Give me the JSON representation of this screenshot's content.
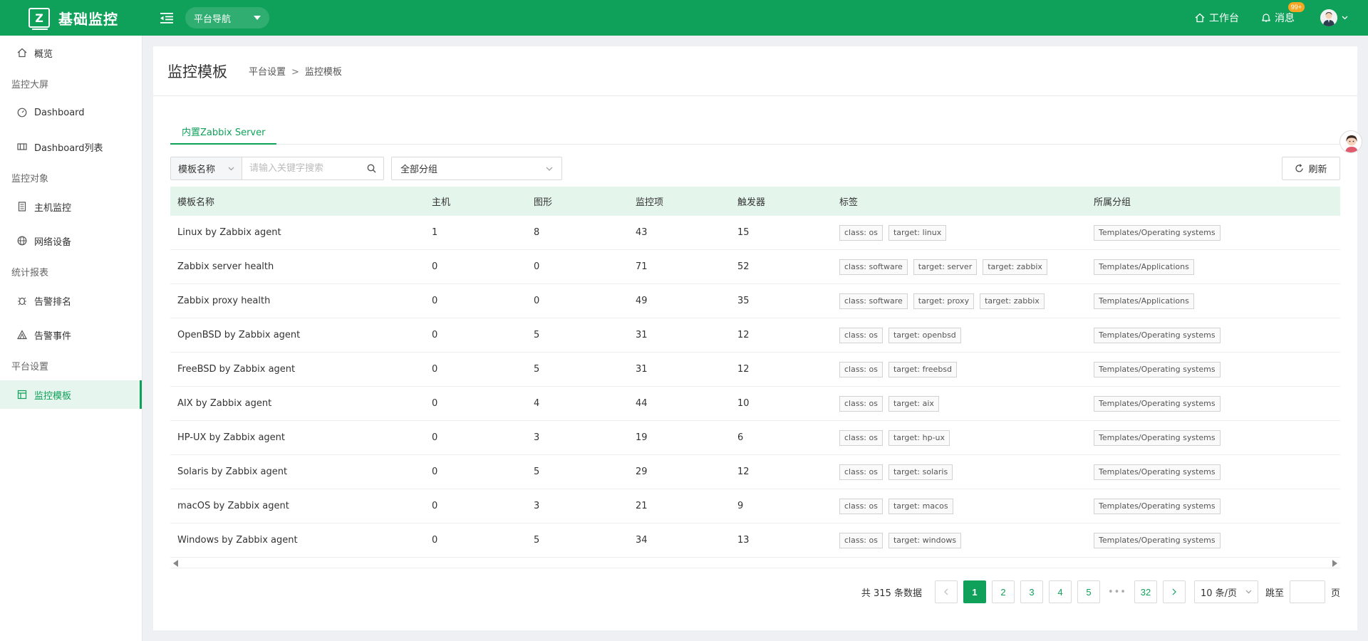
{
  "colors": {
    "brand": "#0fa15a",
    "sidebar_active_bg": "#e6f5ed",
    "table_head_bg": "#e4f5ec"
  },
  "header": {
    "logo_letter": "Z",
    "app_title": "基础监控",
    "nav_select": "平台导航",
    "workbench": "工作台",
    "messages": "消息",
    "messages_badge": "99+"
  },
  "sidebar": {
    "overview": "概览",
    "groups": {
      "screen": "监控大屏",
      "objects": "监控对象",
      "reports": "统计报表",
      "settings": "平台设置"
    },
    "items": {
      "dashboard": "Dashboard",
      "dashboard_list": "Dashboard列表",
      "host_monitor": "主机监控",
      "network_device": "网络设备",
      "alert_rank": "告警排名",
      "alert_event": "告警事件",
      "templates": "监控模板"
    }
  },
  "page": {
    "title": "监控模板",
    "breadcrumb": [
      "平台设置",
      "监控模板"
    ],
    "breadcrumb_sep": ">",
    "tab": "内置Zabbix Server"
  },
  "filters": {
    "search_type": "模板名称",
    "search_placeholder": "请输入关键字搜索",
    "group_select": "全部分组",
    "refresh": "刷新"
  },
  "table": {
    "headers": [
      "模板名称",
      "主机",
      "图形",
      "监控项",
      "触发器",
      "标签",
      "所属分组"
    ],
    "rows": [
      {
        "name": "Linux by Zabbix agent",
        "hosts": "1",
        "graphs": "8",
        "items": "43",
        "triggers": "15",
        "tags": [
          "class: os",
          "target: linux"
        ],
        "group": "Templates/Operating systems"
      },
      {
        "name": "Zabbix server health",
        "hosts": "0",
        "graphs": "0",
        "items": "71",
        "triggers": "52",
        "tags": [
          "class: software",
          "target: server",
          "target: zabbix"
        ],
        "group": "Templates/Applications"
      },
      {
        "name": "Zabbix proxy health",
        "hosts": "0",
        "graphs": "0",
        "items": "49",
        "triggers": "35",
        "tags": [
          "class: software",
          "target: proxy",
          "target: zabbix"
        ],
        "group": "Templates/Applications"
      },
      {
        "name": "OpenBSD by Zabbix agent",
        "hosts": "0",
        "graphs": "5",
        "items": "31",
        "triggers": "12",
        "tags": [
          "class: os",
          "target: openbsd"
        ],
        "group": "Templates/Operating systems"
      },
      {
        "name": "FreeBSD by Zabbix agent",
        "hosts": "0",
        "graphs": "5",
        "items": "31",
        "triggers": "12",
        "tags": [
          "class: os",
          "target: freebsd"
        ],
        "group": "Templates/Operating systems"
      },
      {
        "name": "AIX by Zabbix agent",
        "hosts": "0",
        "graphs": "4",
        "items": "44",
        "triggers": "10",
        "tags": [
          "class: os",
          "target: aix"
        ],
        "group": "Templates/Operating systems"
      },
      {
        "name": "HP-UX by Zabbix agent",
        "hosts": "0",
        "graphs": "3",
        "items": "19",
        "triggers": "6",
        "tags": [
          "class: os",
          "target: hp-ux"
        ],
        "group": "Templates/Operating systems"
      },
      {
        "name": "Solaris by Zabbix agent",
        "hosts": "0",
        "graphs": "5",
        "items": "29",
        "triggers": "12",
        "tags": [
          "class: os",
          "target: solaris"
        ],
        "group": "Templates/Operating systems"
      },
      {
        "name": "macOS by Zabbix agent",
        "hosts": "0",
        "graphs": "3",
        "items": "21",
        "triggers": "9",
        "tags": [
          "class: os",
          "target: macos"
        ],
        "group": "Templates/Operating systems"
      },
      {
        "name": "Windows by Zabbix agent",
        "hosts": "0",
        "graphs": "5",
        "items": "34",
        "triggers": "13",
        "tags": [
          "class: os",
          "target: windows"
        ],
        "group": "Templates/Operating systems"
      }
    ]
  },
  "pagination": {
    "total": "共 315 条数据",
    "pages": [
      "1",
      "2",
      "3",
      "4",
      "5"
    ],
    "ellipsis": "•••",
    "last_page": "32",
    "current": "1",
    "page_size": "10 条/页",
    "jump_label": "跳至",
    "jump_unit": "页"
  }
}
